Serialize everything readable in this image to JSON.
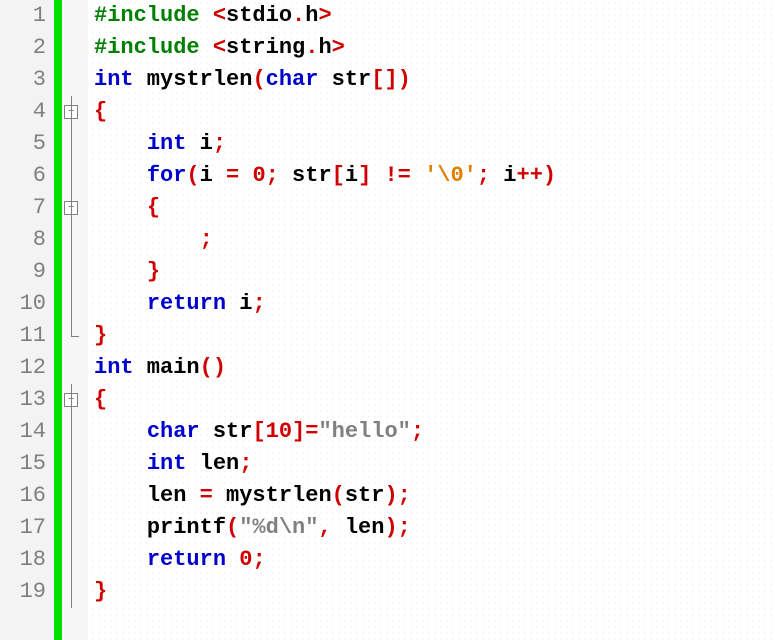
{
  "minus": "−",
  "lines": [
    {
      "n": "1",
      "fold": "none",
      "indent": 1,
      "tokens": [
        {
          "cls": "kw-green",
          "t": "#include "
        },
        {
          "cls": "op-red",
          "t": "<"
        },
        {
          "cls": "ident",
          "t": "stdio"
        },
        {
          "cls": "op-red",
          "t": "."
        },
        {
          "cls": "ident",
          "t": "h"
        },
        {
          "cls": "op-red",
          "t": ">"
        }
      ]
    },
    {
      "n": "2",
      "fold": "none",
      "indent": 1,
      "tokens": [
        {
          "cls": "kw-green",
          "t": "#include "
        },
        {
          "cls": "op-red",
          "t": "<"
        },
        {
          "cls": "ident",
          "t": "string"
        },
        {
          "cls": "op-red",
          "t": "."
        },
        {
          "cls": "ident",
          "t": "h"
        },
        {
          "cls": "op-red",
          "t": ">"
        }
      ]
    },
    {
      "n": "3",
      "fold": "none",
      "indent": 1,
      "tokens": [
        {
          "cls": "kw-blue",
          "t": "int"
        },
        {
          "cls": "ident",
          "t": " mystrlen"
        },
        {
          "cls": "op-red",
          "t": "("
        },
        {
          "cls": "kw-blue",
          "t": "char"
        },
        {
          "cls": "ident",
          "t": " str"
        },
        {
          "cls": "op-red",
          "t": "[])"
        }
      ]
    },
    {
      "n": "4",
      "fold": "box",
      "indent": 1,
      "tokens": [
        {
          "cls": "op-red",
          "t": "{"
        }
      ]
    },
    {
      "n": "5",
      "fold": "line",
      "indent": 2,
      "tokens": [
        {
          "cls": "kw-blue",
          "t": "int"
        },
        {
          "cls": "ident",
          "t": " i"
        },
        {
          "cls": "op-red",
          "t": ";"
        }
      ]
    },
    {
      "n": "6",
      "fold": "line",
      "indent": 2,
      "tokens": [
        {
          "cls": "kw-blue",
          "t": "for"
        },
        {
          "cls": "op-red",
          "t": "("
        },
        {
          "cls": "ident",
          "t": "i "
        },
        {
          "cls": "op-red",
          "t": "= "
        },
        {
          "cls": "num-red",
          "t": "0"
        },
        {
          "cls": "op-red",
          "t": "; "
        },
        {
          "cls": "ident",
          "t": "str"
        },
        {
          "cls": "op-red",
          "t": "["
        },
        {
          "cls": "ident",
          "t": "i"
        },
        {
          "cls": "op-red",
          "t": "] != "
        },
        {
          "cls": "chr-or",
          "t": "'\\0'"
        },
        {
          "cls": "op-red",
          "t": "; "
        },
        {
          "cls": "ident",
          "t": "i"
        },
        {
          "cls": "op-red",
          "t": "++)"
        }
      ]
    },
    {
      "n": "7",
      "fold": "box",
      "indent": 2,
      "tokens": [
        {
          "cls": "op-red",
          "t": "{"
        }
      ]
    },
    {
      "n": "8",
      "fold": "line",
      "indent": 3,
      "tokens": [
        {
          "cls": "op-red",
          "t": ";"
        }
      ]
    },
    {
      "n": "9",
      "fold": "line",
      "indent": 2,
      "tokens": [
        {
          "cls": "op-red",
          "t": "}"
        }
      ]
    },
    {
      "n": "10",
      "fold": "line",
      "indent": 2,
      "tokens": [
        {
          "cls": "kw-blue",
          "t": "return"
        },
        {
          "cls": "ident",
          "t": " i"
        },
        {
          "cls": "op-red",
          "t": ";"
        }
      ]
    },
    {
      "n": "11",
      "fold": "corner",
      "indent": 1,
      "tokens": [
        {
          "cls": "op-red",
          "t": "}"
        }
      ]
    },
    {
      "n": "12",
      "fold": "none",
      "indent": 1,
      "tokens": [
        {
          "cls": "kw-blue",
          "t": "int"
        },
        {
          "cls": "ident",
          "t": " main"
        },
        {
          "cls": "op-red",
          "t": "()"
        }
      ]
    },
    {
      "n": "13",
      "fold": "box",
      "indent": 1,
      "tokens": [
        {
          "cls": "op-red",
          "t": "{"
        }
      ]
    },
    {
      "n": "14",
      "fold": "line",
      "indent": 2,
      "tokens": [
        {
          "cls": "kw-blue",
          "t": "char"
        },
        {
          "cls": "ident",
          "t": " str"
        },
        {
          "cls": "op-red",
          "t": "["
        },
        {
          "cls": "num-red",
          "t": "10"
        },
        {
          "cls": "op-red",
          "t": "]="
        },
        {
          "cls": "str-gray",
          "t": "\"hello\""
        },
        {
          "cls": "op-red",
          "t": ";"
        }
      ]
    },
    {
      "n": "15",
      "fold": "line",
      "indent": 2,
      "tokens": [
        {
          "cls": "kw-blue",
          "t": "int"
        },
        {
          "cls": "ident",
          "t": " len"
        },
        {
          "cls": "op-red",
          "t": ";"
        }
      ]
    },
    {
      "n": "16",
      "fold": "line",
      "indent": 2,
      "tokens": [
        {
          "cls": "ident",
          "t": "len "
        },
        {
          "cls": "op-red",
          "t": "= "
        },
        {
          "cls": "ident",
          "t": "mystrlen"
        },
        {
          "cls": "op-red",
          "t": "("
        },
        {
          "cls": "ident",
          "t": "str"
        },
        {
          "cls": "op-red",
          "t": ");"
        }
      ]
    },
    {
      "n": "17",
      "fold": "line",
      "indent": 2,
      "tokens": [
        {
          "cls": "ident",
          "t": "printf"
        },
        {
          "cls": "op-red",
          "t": "("
        },
        {
          "cls": "str-gray",
          "t": "\"%d\\n\""
        },
        {
          "cls": "op-red",
          "t": ", "
        },
        {
          "cls": "ident",
          "t": "len"
        },
        {
          "cls": "op-red",
          "t": ");"
        }
      ]
    },
    {
      "n": "18",
      "fold": "line",
      "indent": 2,
      "tokens": [
        {
          "cls": "kw-blue",
          "t": "return"
        },
        {
          "cls": "ident",
          "t": " "
        },
        {
          "cls": "num-red",
          "t": "0"
        },
        {
          "cls": "op-red",
          "t": ";"
        }
      ]
    },
    {
      "n": "19",
      "fold": "line",
      "indent": 1,
      "tokens": [
        {
          "cls": "op-red",
          "t": "}"
        }
      ]
    }
  ]
}
